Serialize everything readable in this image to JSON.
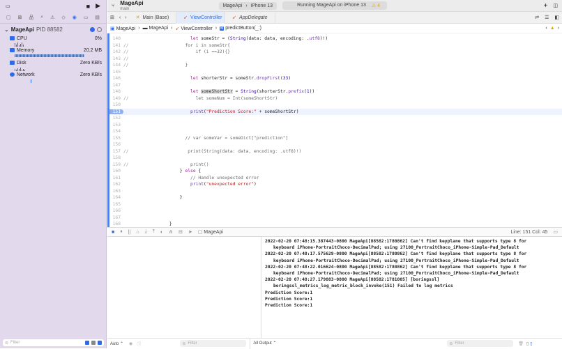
{
  "sidebar": {
    "process": {
      "name": "MageApi",
      "pid": "PID 88582"
    },
    "gauges": [
      {
        "label": "CPU",
        "value": "0%"
      },
      {
        "label": "Memory",
        "value": "20.2 MB"
      },
      {
        "label": "Disk",
        "value": "Zero KB/s"
      },
      {
        "label": "Network",
        "value": "Zero KB/s"
      }
    ],
    "filter_placeholder": "Filter"
  },
  "toolbar": {
    "project": "MageApi",
    "branch": "main",
    "scheme": "MageApi",
    "device": "iPhone 13",
    "status": "Running MageApi on iPhone 13",
    "warnings": "4"
  },
  "tabs": [
    {
      "label": "Main (Base)"
    },
    {
      "label": "ViewController"
    },
    {
      "label": "AppDelegate"
    }
  ],
  "breadcrumb": [
    "MageApi",
    "MageApi",
    "ViewController",
    "predictButton(_:)"
  ],
  "editor": {
    "current_line": "151",
    "lines": [
      {
        "n": "140",
        "g": "",
        "s": [
          [
            "                   ",
            "id"
          ],
          [
            "let ",
            "kw"
          ],
          [
            "someStr = (",
            "id"
          ],
          [
            "String",
            "ty"
          ],
          [
            "(data: data, encoding: .",
            "id"
          ],
          [
            "utf8",
            "fn"
          ],
          [
            ")!)",
            "id"
          ]
        ]
      },
      {
        "n": "141",
        "g": "//",
        "s": [
          [
            "                 for i in someStr{",
            "cm"
          ]
        ]
      },
      {
        "n": "142",
        "g": "//",
        "s": [
          [
            "                     if (i ==32){}",
            "cm"
          ]
        ]
      },
      {
        "n": "143",
        "g": "//",
        "s": [
          [
            "",
            "cm"
          ]
        ]
      },
      {
        "n": "144",
        "g": "//",
        "s": [
          [
            "                 }",
            "cm"
          ]
        ]
      },
      {
        "n": "145",
        "g": "",
        "s": []
      },
      {
        "n": "146",
        "g": "",
        "s": [
          [
            "                   ",
            "id"
          ],
          [
            "let ",
            "kw"
          ],
          [
            "shorterStr = someStr.",
            "id"
          ],
          [
            "dropFirst",
            "fn"
          ],
          [
            "(",
            "id"
          ],
          [
            "33",
            "nu"
          ],
          [
            ")",
            "id"
          ]
        ]
      },
      {
        "n": "147",
        "g": "",
        "s": []
      },
      {
        "n": "148",
        "g": "",
        "s": [
          [
            "                   ",
            "id"
          ],
          [
            "let ",
            "kw"
          ],
          [
            "someShortStr",
            "hl"
          ],
          [
            " = ",
            "id"
          ],
          [
            "String",
            "ty"
          ],
          [
            "(shorterStr.",
            "id"
          ],
          [
            "prefix",
            "fn"
          ],
          [
            "(",
            "id"
          ],
          [
            "1",
            "nu"
          ],
          [
            "))",
            "id"
          ]
        ]
      },
      {
        "n": "149",
        "g": "//",
        "s": [
          [
            "                     let someNum = Int(someShortStr)",
            "cm"
          ]
        ]
      },
      {
        "n": "150",
        "g": "",
        "s": []
      },
      {
        "n": "151",
        "g": "",
        "s": [
          [
            "                   ",
            "id"
          ],
          [
            "print",
            "fn"
          ],
          [
            "(",
            "id"
          ],
          [
            "\"Prediction Score:\"",
            "st"
          ],
          [
            " + someShortStr)",
            "id"
          ]
        ]
      },
      {
        "n": "152",
        "g": "",
        "s": []
      },
      {
        "n": "153",
        "g": "",
        "s": []
      },
      {
        "n": "154",
        "g": "",
        "s": []
      },
      {
        "n": "155",
        "g": "",
        "s": [
          [
            "                 // var someVar = someDict[\"prediction\"]",
            "cm"
          ]
        ]
      },
      {
        "n": "156",
        "g": "",
        "s": []
      },
      {
        "n": "157",
        "g": "//",
        "s": [
          [
            "                  print(String(data: data, encoding: .utf8)!)",
            "cm"
          ]
        ]
      },
      {
        "n": "158",
        "g": "",
        "s": []
      },
      {
        "n": "159",
        "g": "//",
        "s": [
          [
            "                   print()",
            "cm"
          ]
        ]
      },
      {
        "n": "160",
        "g": "",
        "s": [
          [
            "               } ",
            "id"
          ],
          [
            "else",
            "kw"
          ],
          [
            " {",
            "id"
          ]
        ]
      },
      {
        "n": "161",
        "g": "",
        "s": [
          [
            "                   // Handle unexpected error",
            "cm"
          ]
        ]
      },
      {
        "n": "162",
        "g": "",
        "s": [
          [
            "                   ",
            "id"
          ],
          [
            "print",
            "fn"
          ],
          [
            "(",
            "id"
          ],
          [
            "\"unexpected error\"",
            "st"
          ],
          [
            ")",
            "id"
          ]
        ]
      },
      {
        "n": "163",
        "g": "",
        "s": []
      },
      {
        "n": "164",
        "g": "",
        "s": [
          [
            "               }",
            "id"
          ]
        ]
      },
      {
        "n": "165",
        "g": "",
        "s": []
      },
      {
        "n": "166",
        "g": "",
        "s": []
      },
      {
        "n": "167",
        "g": "",
        "s": []
      },
      {
        "n": "168",
        "g": "",
        "s": [
          [
            "           }",
            "id"
          ]
        ]
      }
    ]
  },
  "debugbar": {
    "target": "MageApi",
    "position": "Line: 151  Col: 45"
  },
  "console": [
    {
      "t": "2022-02-20 07:48:15.387443-0800 MageApi[88582:1780862] Can't find keyplane that supports type 8 for",
      "i": false
    },
    {
      "t": "keyboard iPhone-PortraitChoco-DecimalPad; using 27100_PortraitChoco_iPhone-Simple-Pad_Default",
      "i": true
    },
    {
      "t": "2022-02-20 07:48:17.575629-0800 MageApi[88582:1780862] Can't find keyplane that supports type 8 for",
      "i": false
    },
    {
      "t": "keyboard iPhone-PortraitChoco-DecimalPad; using 27100_PortraitChoco_iPhone-Simple-Pad_Default",
      "i": true
    },
    {
      "t": "2022-02-20 07:48:22.016624-0800 MageApi[88582:1780862] Can't find keyplane that supports type 8 for",
      "i": false
    },
    {
      "t": "keyboard iPhone-PortraitChoco-DecimalPad; using 27100_PortraitChoco_iPhone-Simple-Pad_Default",
      "i": true
    },
    {
      "t": "2022-02-20 07:48:27.179883-0800 MageApi[88582:1781005] [boringssl]",
      "i": false
    },
    {
      "t": "boringssl_metrics_log_metric_block_invoke(151) Failed to log metrics",
      "i": true
    },
    {
      "t": "Prediction Score:1",
      "i": false
    },
    {
      "t": "Prediction Score:1",
      "i": false
    },
    {
      "t": "Prediction Score:1",
      "i": false
    }
  ],
  "bottombar": {
    "auto_label": "Auto ⌃",
    "vars_filter": "Filter",
    "output_label": "All Output ⌃",
    "console_filter": "Filter"
  }
}
